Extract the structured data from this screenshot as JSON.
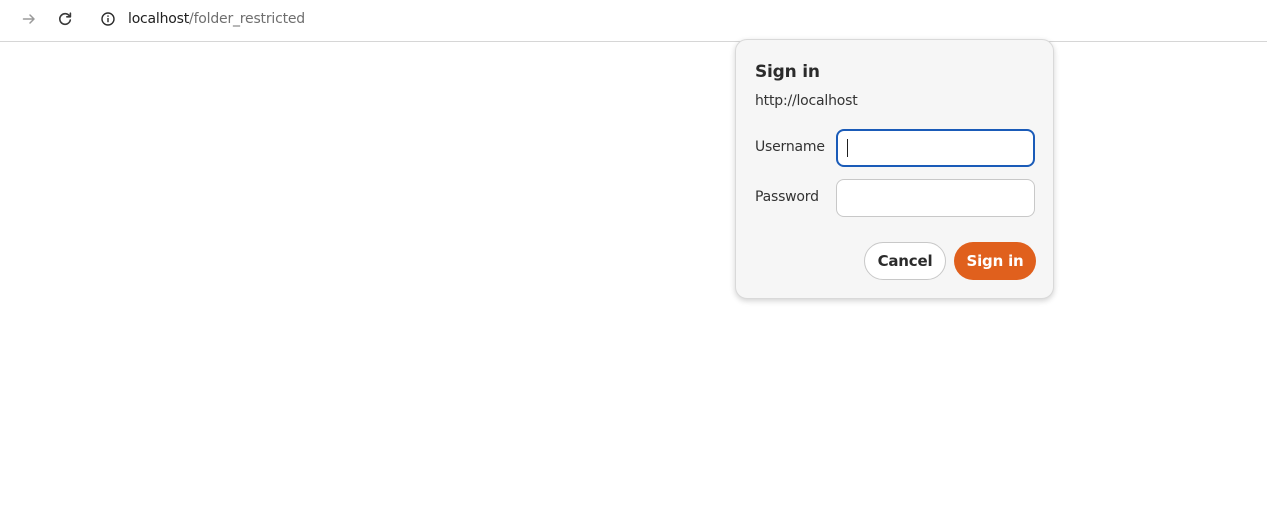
{
  "toolbar": {
    "forward_icon": "arrow-right-icon",
    "reload_icon": "reload-icon",
    "site_info_icon": "info-icon",
    "url_host": "localhost",
    "url_path": "/folder_restricted"
  },
  "dialog": {
    "title": "Sign in",
    "origin": "http://localhost",
    "username_label": "Username",
    "username_value": "",
    "password_label": "Password",
    "password_value": "",
    "cancel_label": "Cancel",
    "signin_label": "Sign in"
  },
  "colors": {
    "accent": "#e0601d",
    "focus_ring": "#1a5bb8",
    "dialog_bg": "#f6f6f6"
  }
}
